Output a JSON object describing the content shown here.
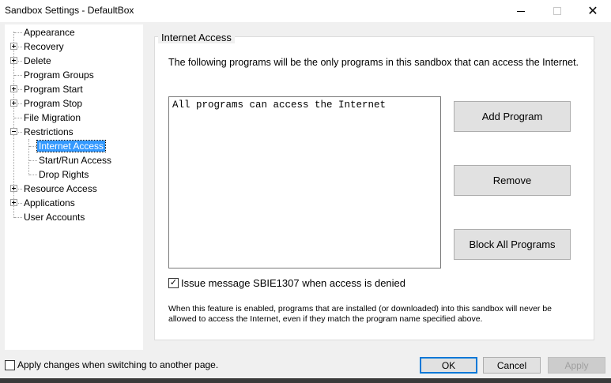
{
  "window": {
    "title": "Sandbox Settings - DefaultBox",
    "close_glyph": "✕"
  },
  "tree": {
    "items": [
      {
        "label": "Appearance",
        "expander": "none"
      },
      {
        "label": "Recovery",
        "expander": "plus"
      },
      {
        "label": "Delete",
        "expander": "plus"
      },
      {
        "label": "Program Groups",
        "expander": "none"
      },
      {
        "label": "Program Start",
        "expander": "plus"
      },
      {
        "label": "Program Stop",
        "expander": "plus"
      },
      {
        "label": "File Migration",
        "expander": "none"
      },
      {
        "label": "Restrictions",
        "expander": "minus"
      },
      {
        "label": "Internet Access",
        "expander": "none",
        "selected": true
      },
      {
        "label": "Start/Run Access",
        "expander": "none"
      },
      {
        "label": "Drop Rights",
        "expander": "none"
      },
      {
        "label": "Resource Access",
        "expander": "plus"
      },
      {
        "label": "Applications",
        "expander": "plus"
      },
      {
        "label": "User Accounts",
        "expander": "none"
      }
    ]
  },
  "panel": {
    "group_title": "Internet Access",
    "description": "The following programs will be the only programs in this sandbox that can access the Internet.",
    "list_items": [
      "All programs can access the Internet"
    ],
    "buttons": {
      "add": "Add Program",
      "remove": "Remove",
      "block_all": "Block All Programs"
    },
    "checkbox_label": "Issue message SBIE1307 when access is denied",
    "checkbox_checked": true,
    "note": "When this feature is enabled, programs that are installed (or downloaded) into this sandbox will never be allowed to access the Internet, even if they match the program name specified above."
  },
  "footer": {
    "apply_on_switch_label": "Apply changes when switching to another page.",
    "apply_on_switch_checked": false,
    "ok": "OK",
    "cancel": "Cancel",
    "apply": "Apply"
  },
  "colors": {
    "selection": "#3399ff",
    "dialog_bg": "#f0f0f0",
    "button_bg": "#e1e1e1",
    "default_button_border": "#0078d7"
  }
}
